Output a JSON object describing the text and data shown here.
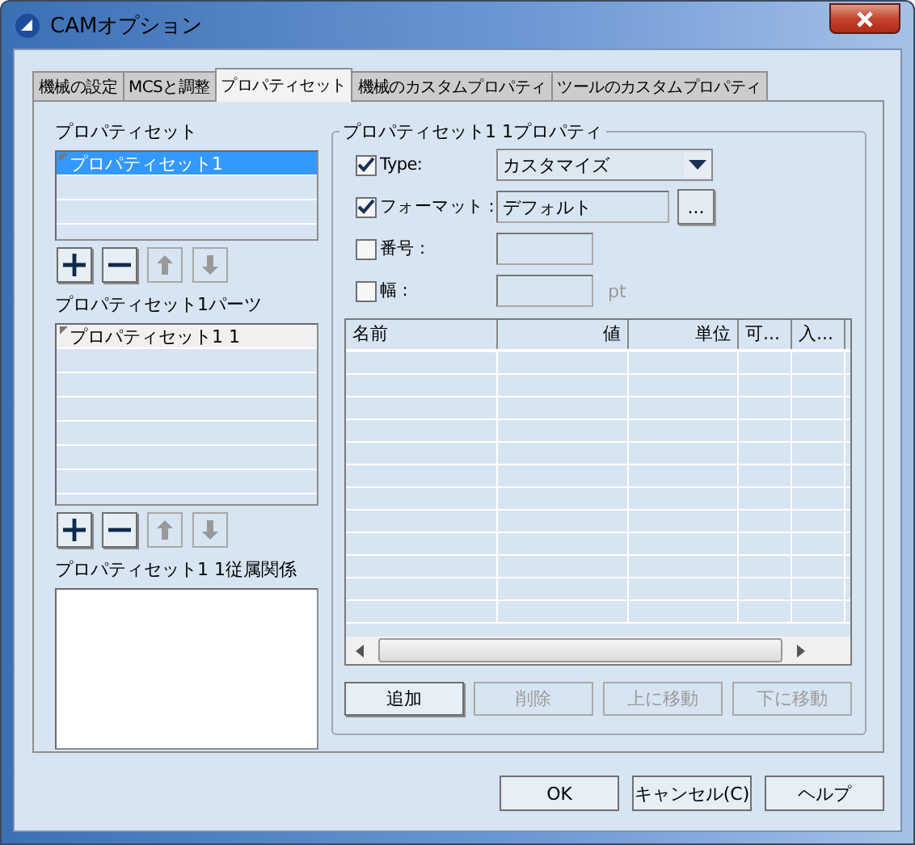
{
  "window": {
    "title": "CAMオプション"
  },
  "tabs": [
    {
      "label": "機械の設定",
      "selected": false
    },
    {
      "label": "MCSと調整",
      "selected": false
    },
    {
      "label": "プロパティセット",
      "selected": true
    },
    {
      "label": "機械のカスタムプロパティ",
      "selected": false
    },
    {
      "label": "ツールのカスタムプロパティ",
      "selected": false
    }
  ],
  "lists": [
    {
      "label": "プロパティセット",
      "focused": true,
      "items": [
        {
          "text": "プロパティセット1",
          "selected": true
        }
      ],
      "tools": [
        {
          "kind": "add",
          "disabled": false
        },
        {
          "kind": "remove",
          "disabled": false
        },
        {
          "kind": "up",
          "disabled": true
        },
        {
          "kind": "down",
          "disabled": true
        }
      ]
    },
    {
      "label": "プロパティセット1パーツ",
      "focused": false,
      "items": [
        {
          "text": "プロパティセット1 1",
          "selected": true
        }
      ],
      "tools": [
        {
          "kind": "add",
          "disabled": false
        },
        {
          "kind": "remove",
          "disabled": false
        },
        {
          "kind": "up",
          "disabled": true
        },
        {
          "kind": "down",
          "disabled": true
        }
      ]
    },
    {
      "label": "プロパティセット1 1従属関係"
    }
  ],
  "properties": {
    "title": "プロパティセット1 1プロパティ",
    "fields": [
      {
        "kind": "dropdown",
        "label": "Type:",
        "checked": true,
        "value": "カスタマイズ"
      },
      {
        "kind": "browse",
        "label": "フォーマット :",
        "checked": true,
        "value": "デフォルト",
        "button": "..."
      },
      {
        "kind": "text",
        "label": "番号 :",
        "checked": false
      },
      {
        "kind": "unit",
        "label": "幅 :",
        "checked": false,
        "unit": "pt"
      }
    ],
    "table": {
      "columns": [
        "名前",
        "値",
        "単位",
        "可...",
        "入..."
      ]
    },
    "actions": [
      {
        "label": "追加",
        "disabled": false
      },
      {
        "label": "削除",
        "disabled": true
      },
      {
        "label": "上に移動",
        "disabled": true
      },
      {
        "label": "下に移動",
        "disabled": true
      }
    ]
  },
  "buttons": [
    "OK",
    "キャンセル(C)",
    "ヘルプ"
  ]
}
